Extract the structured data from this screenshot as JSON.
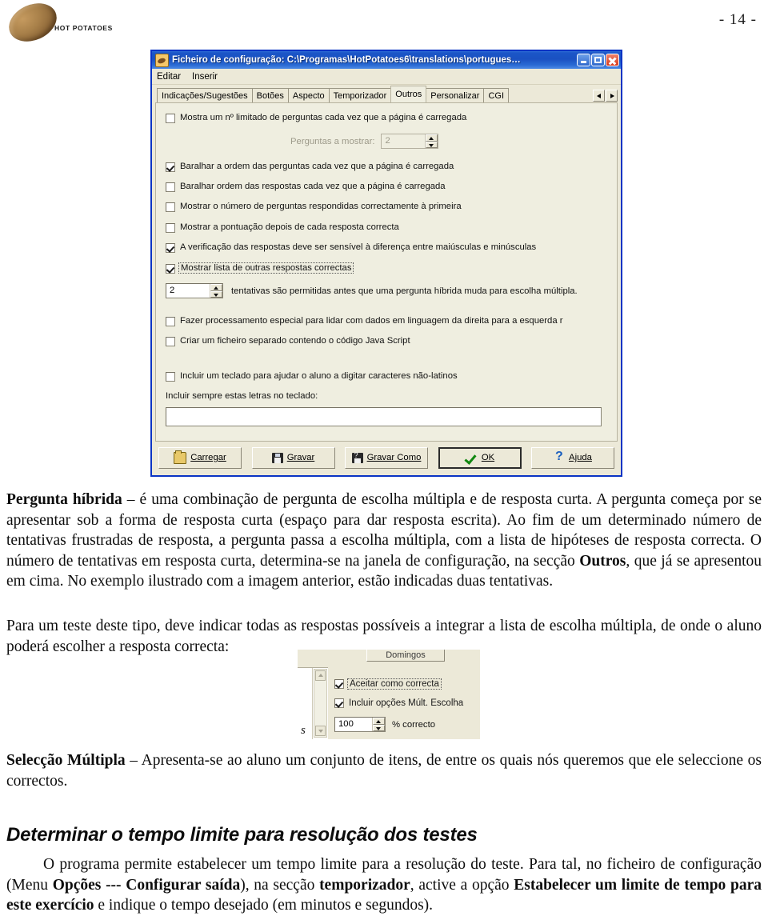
{
  "page": {
    "number_label": "- 14 -",
    "logo_text": "HOT POTATOES"
  },
  "dialog": {
    "title": "Ficheiro de configuração: C:\\Programas\\HotPotatoes6\\translations\\portugues…",
    "window_icon": "potato-icon",
    "window_buttons": {
      "minimize": "minimize-icon",
      "maximize": "maximize-icon",
      "close": "close-icon"
    },
    "menu": [
      "Editar",
      "Inserir"
    ],
    "tabs": [
      {
        "label": "Indicações/Sugestões",
        "active": false
      },
      {
        "label": "Botões",
        "active": false
      },
      {
        "label": "Aspecto",
        "active": false
      },
      {
        "label": "Temporizador",
        "active": false
      },
      {
        "label": "Outros",
        "active": true
      },
      {
        "label": "Personalizar",
        "active": false
      },
      {
        "label": "CGI",
        "active": false
      }
    ],
    "tab_scroll": {
      "left": "◀",
      "right": "▶"
    },
    "options": [
      {
        "id": "limit-questions",
        "label": "Mostra um nº limitado de perguntas cada vez que a página é carregada",
        "checked": false,
        "focused": false
      },
      {
        "id": "shuffle-questions",
        "label": "Baralhar a ordem das perguntas cada vez que a página é carregada",
        "checked": true,
        "focused": false
      },
      {
        "id": "shuffle-answers",
        "label": "Baralhar ordem das respostas cada vez que a página é carregada",
        "checked": false,
        "focused": false
      },
      {
        "id": "show-first-try-count",
        "label": "Mostrar o  número de perguntas respondidas correctamente à primeira",
        "checked": false,
        "focused": false
      },
      {
        "id": "show-score",
        "label": "Mostrar a pontuação depois de cada resposta correcta",
        "checked": false,
        "focused": false
      },
      {
        "id": "case-sensitive",
        "label": "A verificação das respostas deve ser sensível à diferença entre maiúsculas e minúsculas",
        "checked": true,
        "focused": false
      },
      {
        "id": "show-other-correct",
        "label": "Mostrar lista de outras respostas correctas",
        "checked": true,
        "focused": true
      },
      {
        "id": "rtl-processing",
        "label": "Fazer processamento especial para lidar com dados em linguagem da direita para a esquerda r",
        "checked": false,
        "focused": false
      },
      {
        "id": "separate-js-file",
        "label": "Criar um ficheiro separado contendo o código Java Script",
        "checked": false,
        "focused": false
      },
      {
        "id": "include-keypad",
        "label": "Incluir um teclado para ajudar o aluno a digitar caracteres não-latinos",
        "checked": false,
        "focused": false
      }
    ],
    "questions_to_show": {
      "label": "Perguntas a mostrar:",
      "value": "2",
      "disabled": true
    },
    "attempts": {
      "value": "2",
      "suffix": "tentativas são permitidas antes que uma pergunta híbrida muda para escolha múltipla."
    },
    "keypad_letters": {
      "label": "Incluir sempre estas letras no teclado:",
      "value": ""
    },
    "buttons": [
      {
        "id": "load",
        "label": "Carregar",
        "icon": "folder-icon",
        "default": false
      },
      {
        "id": "save",
        "label": "Gravar",
        "icon": "floppy-icon",
        "default": false
      },
      {
        "id": "save-as",
        "label": "Gravar Como",
        "icon": "floppy-question-icon",
        "default": false
      },
      {
        "id": "ok",
        "label": "OK",
        "icon": "green-check-icon",
        "default": true
      },
      {
        "id": "help",
        "label": "Ajuda",
        "icon": "question-mark-icon",
        "default": false
      }
    ]
  },
  "body": {
    "para1_lead": "Pergunta híbrida",
    "para1_rest": " – é uma combinação de pergunta de escolha múltipla e de resposta curta. A pergunta começa por se apresentar sob a forma de resposta curta (espaço para dar resposta escrita). Ao fim de um determinado número de tentativas frustradas de resposta, a pergunta passa a escolha múltipla, com a lista de hipóteses de resposta correcta. O número de tentativas em resposta curta, determina-se na janela de configuração, na secção ",
    "para1_bold2": "Outros",
    "para1_rest2": ", que já se apresentou em cima. No exemplo ilustrado com a imagem anterior, estão indicadas duas tentativas.",
    "para2": "Para um teste deste tipo, deve indicar todas as respostas possíveis a integrar a lista de escolha múltipla, de onde o aluno poderá escolher a resposta correcta:",
    "para3_lead": "Selecção Múltipla",
    "para3_rest": " – Apresenta-se ao aluno um conjunto de itens, de entre os quais nós queremos que ele seleccione os correctos.",
    "heading2": "Determinar o tempo limite para resolução dos testes",
    "para4_a": "O programa permite estabelecer um tempo limite para a resolução do teste. Para tal, no ficheiro de configuração (Menu ",
    "para4_b1": "Opções --- Configurar saída",
    "para4_c": "), na secção ",
    "para4_b2": "temporizador",
    "para4_d": ", active a opção ",
    "para4_b3": "Estabelecer um limite de tempo para este exercício",
    "para4_e": " e indique o tempo desejado (em minutos e segundos)."
  },
  "inset": {
    "top_button_label": "Domingos",
    "rows": [
      {
        "id": "accept-as-correct",
        "label": "Aceitar como correcta",
        "checked": true,
        "focused": true
      },
      {
        "id": "include-mc-options",
        "label": "Incluir opções Múlt. Escolha",
        "checked": true,
        "focused": false
      }
    ],
    "percent": {
      "value": "100",
      "label": "% correcto"
    },
    "stray_char": "s"
  }
}
